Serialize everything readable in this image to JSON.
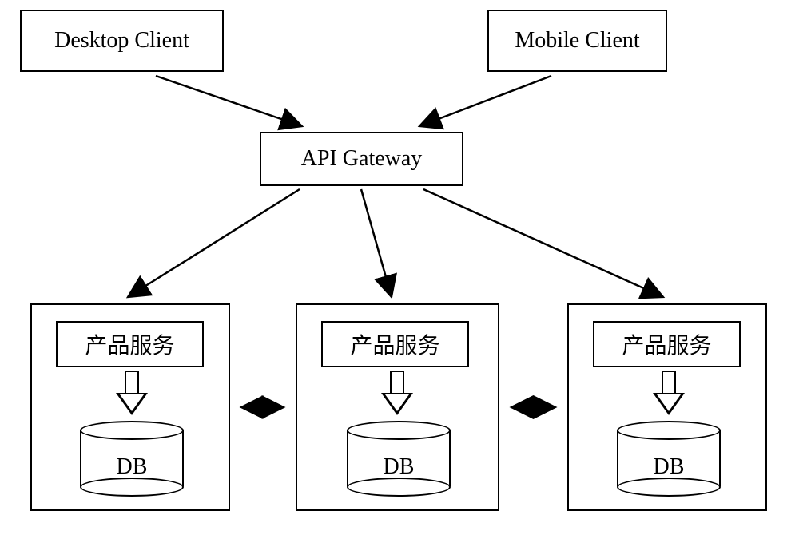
{
  "clients": {
    "desktop": "Desktop Client",
    "mobile": "Mobile Client"
  },
  "gateway": "API Gateway",
  "services": {
    "s1": {
      "label": "产品服务",
      "db": "DB"
    },
    "s2": {
      "label": "产品服务",
      "db": "DB"
    },
    "s3": {
      "label": "产品服务",
      "db": "DB"
    }
  }
}
